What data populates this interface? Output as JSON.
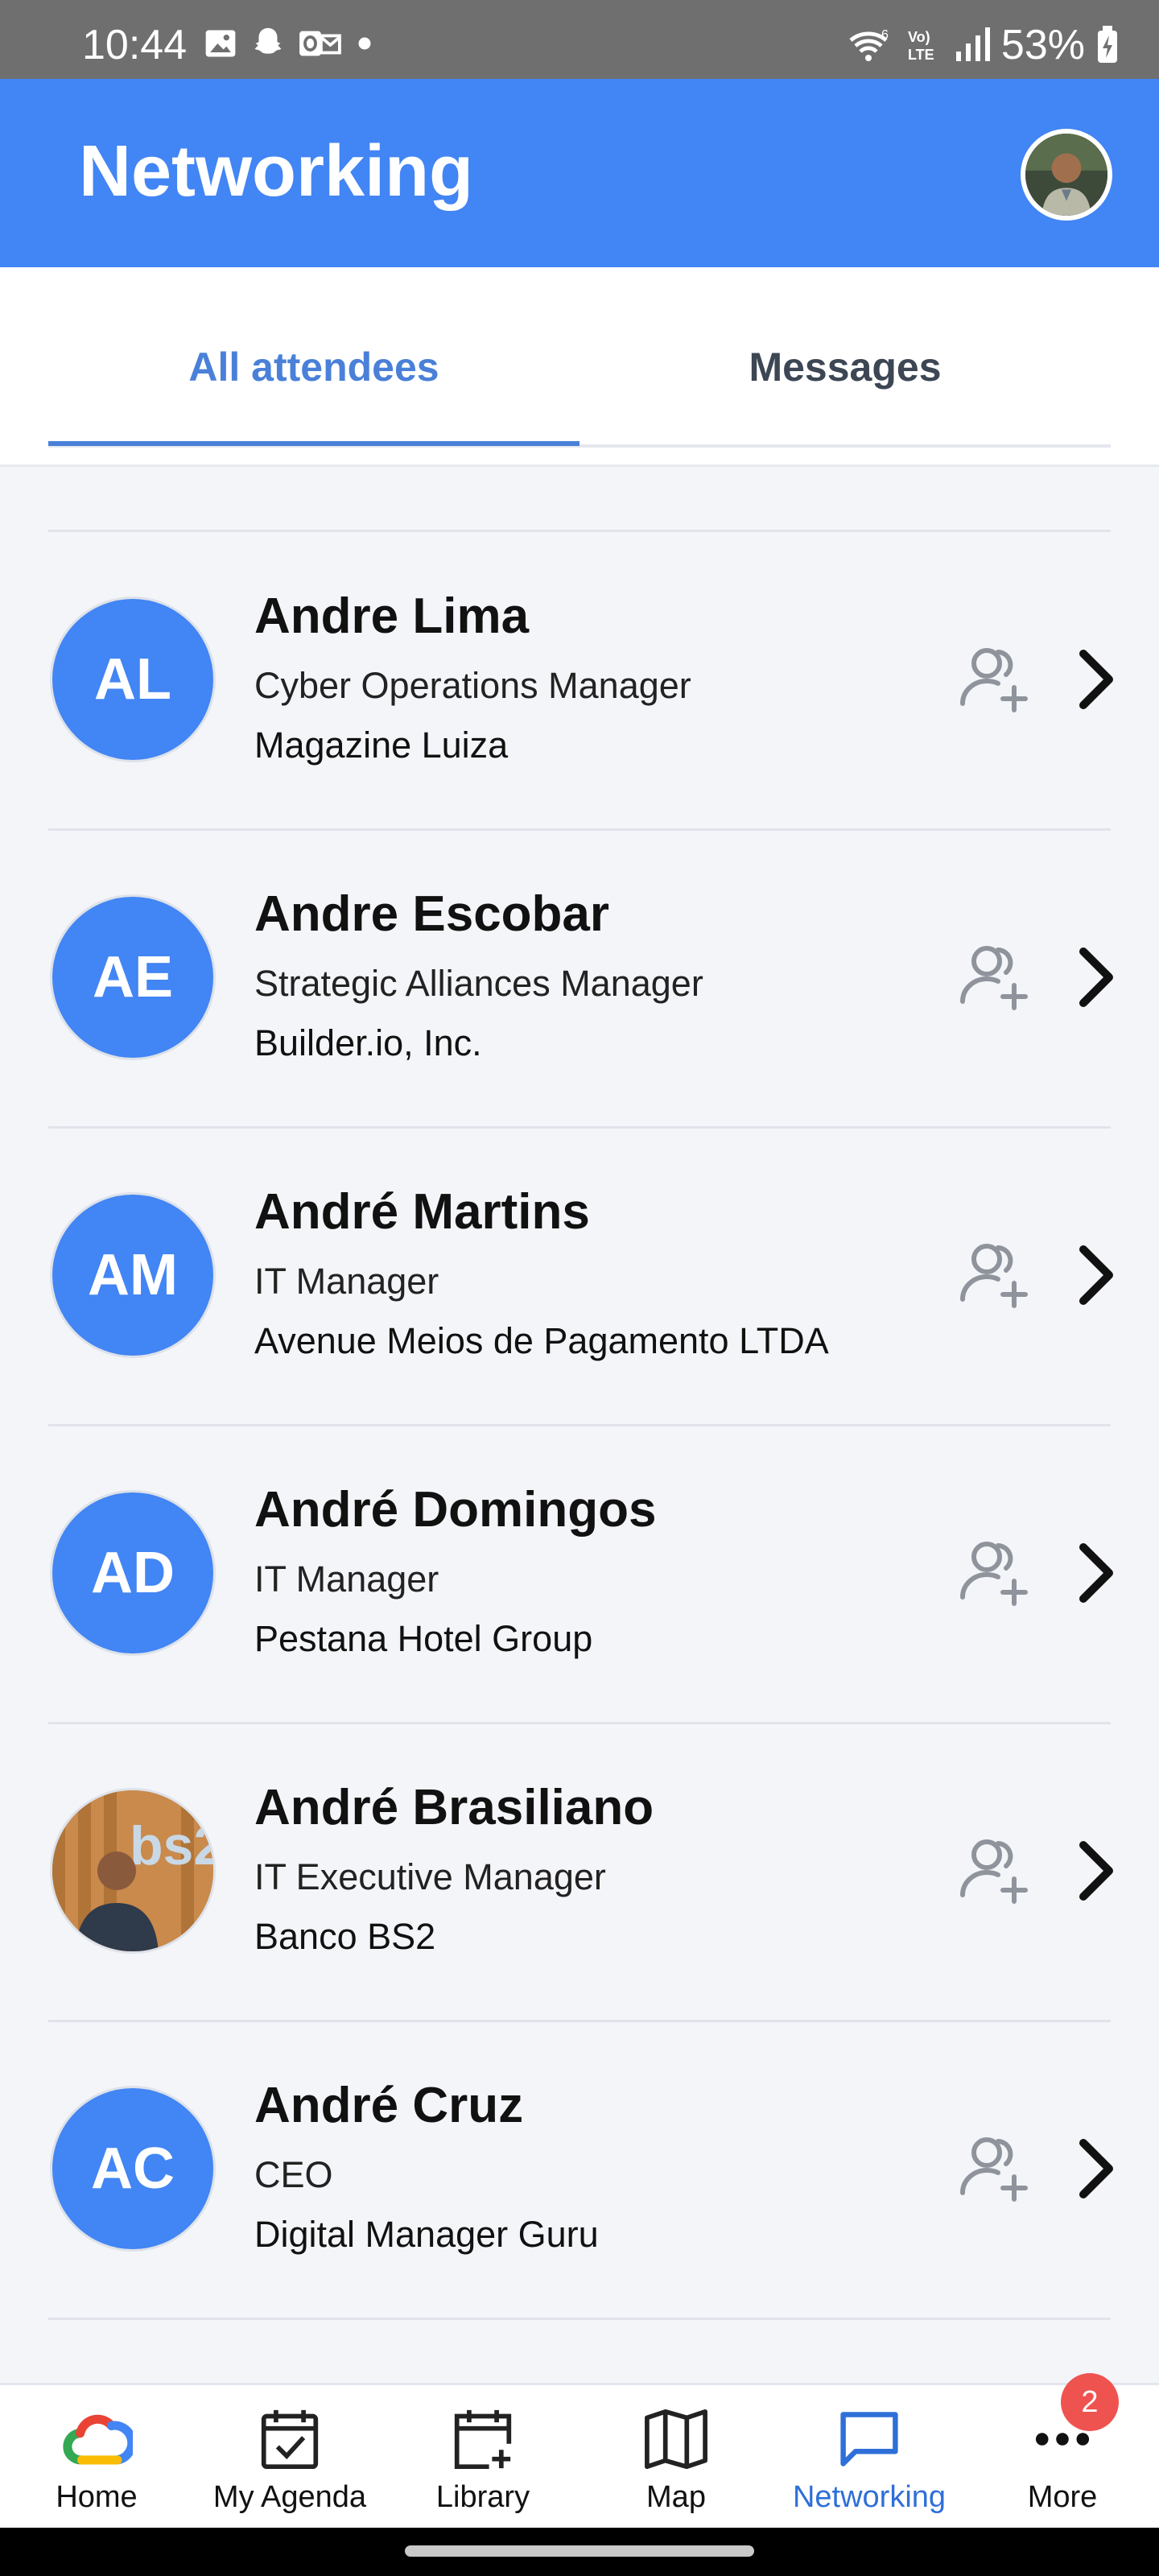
{
  "status_bar": {
    "time": "10:44",
    "battery": "53%",
    "icons": [
      "gallery-icon",
      "snapchat-icon",
      "outlook-icon",
      "dot-icon",
      "wifi-icon",
      "volte-icon",
      "signal-icon",
      "battery-icon"
    ]
  },
  "header": {
    "title": "Networking",
    "brand_color": "#4285f4"
  },
  "tabs": [
    {
      "label": "All attendees",
      "active": true
    },
    {
      "label": "Messages",
      "active": false
    }
  ],
  "attendees": [
    {
      "initials": "AL",
      "name": "Andre Lima",
      "title": "Cyber Operations Manager",
      "company": "Magazine Luiza",
      "has_photo": false
    },
    {
      "initials": "AE",
      "name": "Andre Escobar",
      "title": "Strategic Alliances Manager",
      "company": "Builder.io, Inc.",
      "has_photo": false
    },
    {
      "initials": "AM",
      "name": "André Martins",
      "title": "IT Manager",
      "company": "Avenue Meios de Pagamento LTDA",
      "has_photo": false
    },
    {
      "initials": "AD",
      "name": "André Domingos",
      "title": "IT Manager",
      "company": "Pestana Hotel Group",
      "has_photo": false
    },
    {
      "initials": "",
      "name": "André Brasiliano",
      "title": "IT Executive Manager",
      "company": "Banco BS2",
      "has_photo": true
    },
    {
      "initials": "AC",
      "name": "André Cruz",
      "title": "CEO",
      "company": "Digital Manager Guru",
      "has_photo": false
    }
  ],
  "bottom_nav": [
    {
      "label": "Home",
      "icon": "google-cloud-icon",
      "active": false
    },
    {
      "label": "My Agenda",
      "icon": "calendar-check-icon",
      "active": false
    },
    {
      "label": "Library",
      "icon": "calendar-plus-icon",
      "active": false
    },
    {
      "label": "Map",
      "icon": "map-icon",
      "active": false
    },
    {
      "label": "Networking",
      "icon": "chat-icon",
      "active": true
    },
    {
      "label": "More",
      "icon": "more-icon",
      "active": false
    }
  ],
  "more_badge": "2",
  "colors": {
    "accent": "#4a80d8",
    "avatar": "#4285f4",
    "badge": "#ef5350"
  }
}
